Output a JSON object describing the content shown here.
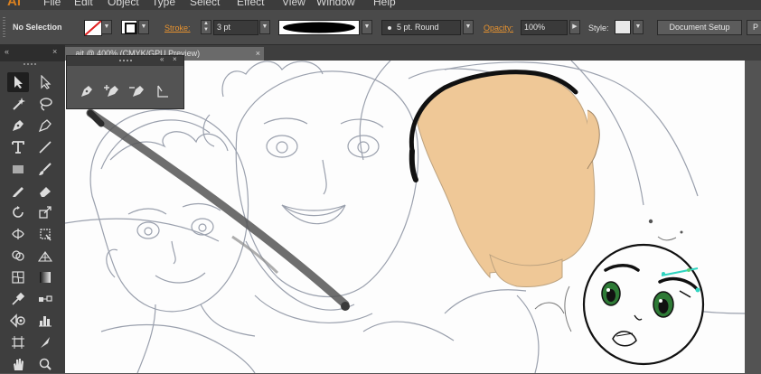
{
  "app": {
    "logo": "Ai"
  },
  "menu": [
    "File",
    "Edit",
    "Object",
    "Type",
    "Select",
    "Effect",
    "View",
    "Window",
    "Help"
  ],
  "control_bar": {
    "selection_label": "No Selection",
    "stroke_label": "Stroke:",
    "stroke_value": "3 pt",
    "brush_label": "5 pt. Round",
    "opacity_label": "Opacity:",
    "opacity_value": "100%",
    "style_label": "Style:",
    "document_setup": "Document Setup",
    "preferences": "P"
  },
  "document_tab": {
    "title": "...ait @ 400% (CMYK/GPU Preview)"
  },
  "tools": [
    "selection-tool",
    "direct-selection-tool",
    "magic-wand-tool",
    "lasso-tool",
    "pen-tool",
    "curvature-tool",
    "type-tool",
    "line-segment-tool",
    "rectangle-tool",
    "paintbrush-tool",
    "pencil-tool",
    "eraser-tool",
    "rotate-tool",
    "scale-tool",
    "width-tool",
    "free-transform-tool",
    "shape-builder-tool",
    "perspective-grid-tool",
    "mesh-tool",
    "gradient-tool",
    "eyedropper-tool",
    "blend-tool",
    "symbol-sprayer-tool",
    "column-graph-tool",
    "artboard-tool",
    "slice-tool"
  ],
  "pen_flyout": [
    "pen-tool",
    "add-anchor-point-tool",
    "delete-anchor-point-tool",
    "anchor-point-tool"
  ],
  "colors": {
    "accent": "#e8932f",
    "panel_dark": "#3e3e3e",
    "skin": "#efc897",
    "artboard": "#fdfdfd"
  }
}
